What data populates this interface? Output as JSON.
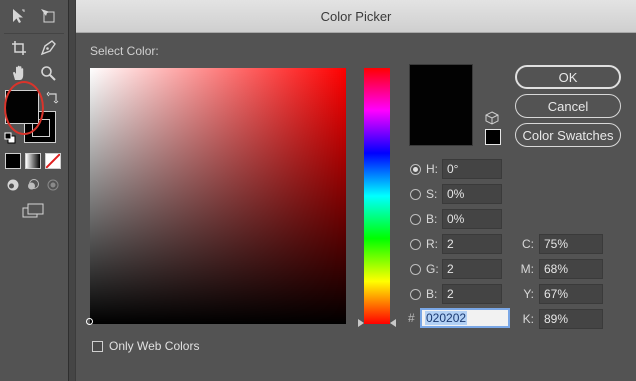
{
  "dialog": {
    "title": "Color Picker",
    "select_label": "Select Color:",
    "buttons": {
      "ok": "OK",
      "cancel": "Cancel",
      "swatches": "Color Swatches"
    },
    "new_color": "#020202"
  },
  "hsb": [
    {
      "label": "H:",
      "value": "0°",
      "selected": true
    },
    {
      "label": "S:",
      "value": "0%",
      "selected": false
    },
    {
      "label": "B:",
      "value": "0%",
      "selected": false
    }
  ],
  "rgb": [
    {
      "label": "R:",
      "value": "2",
      "selected": false
    },
    {
      "label": "G:",
      "value": "2",
      "selected": false
    },
    {
      "label": "B:",
      "value": "2",
      "selected": false
    }
  ],
  "cmyk": [
    {
      "label": "C:",
      "value": "75%"
    },
    {
      "label": "M:",
      "value": "68%"
    },
    {
      "label": "Y:",
      "value": "67%"
    },
    {
      "label": "K:",
      "value": "89%"
    }
  ],
  "hex": {
    "prefix": "#",
    "value": "020202"
  },
  "web_only": {
    "label": "Only Web Colors",
    "checked": false
  },
  "toolbar": {
    "fill_color": "#020202",
    "stroke_color": "#000000",
    "icons": [
      "direct-selection-icon",
      "artboard-icon",
      "crop-icon",
      "pen-icon",
      "hand-icon",
      "zoom-icon",
      "swap-colors-icon",
      "default-colors-icon"
    ]
  }
}
